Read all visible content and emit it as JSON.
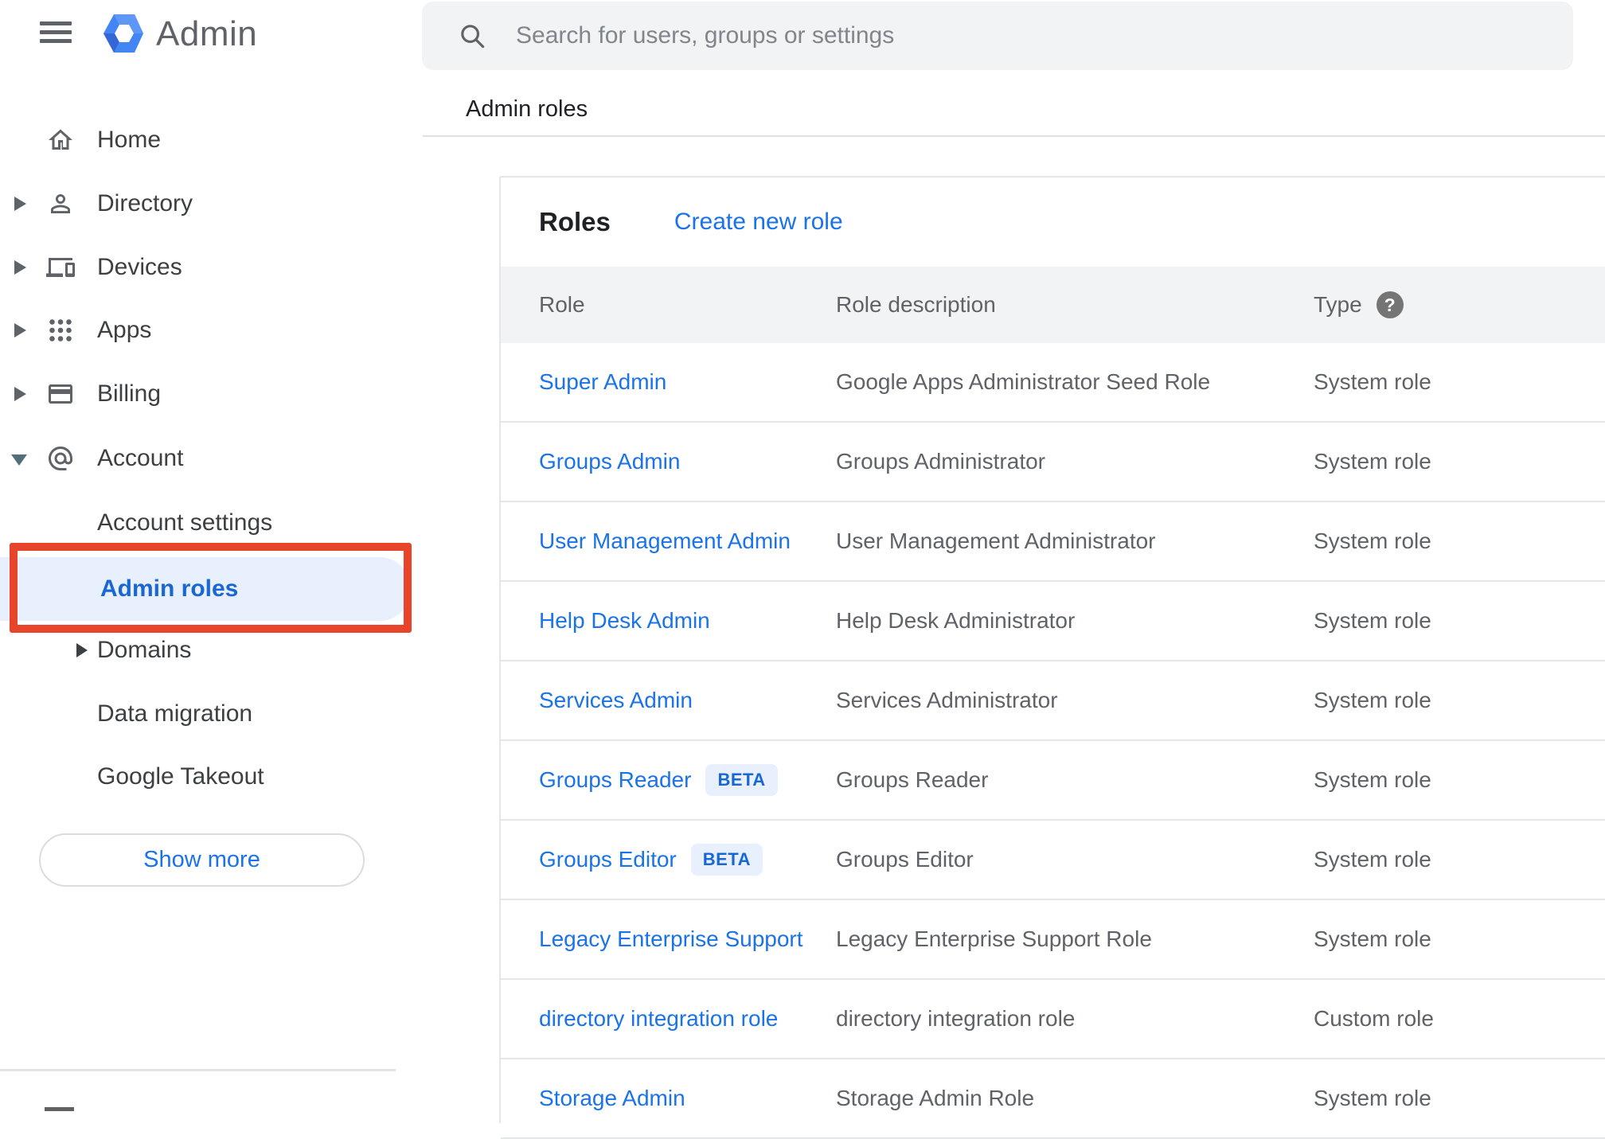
{
  "app": {
    "name": "Admin"
  },
  "search": {
    "placeholder": "Search for users, groups or settings"
  },
  "breadcrumb": {
    "title": "Admin roles"
  },
  "sidebar": {
    "items": [
      {
        "label": "Home"
      },
      {
        "label": "Directory"
      },
      {
        "label": "Devices"
      },
      {
        "label": "Apps"
      },
      {
        "label": "Billing"
      },
      {
        "label": "Account"
      }
    ],
    "account_subitems": [
      {
        "label": "Account settings"
      },
      {
        "label": "Admin roles",
        "selected": true,
        "annotated": true
      },
      {
        "label": "Domains"
      },
      {
        "label": "Data migration"
      },
      {
        "label": "Google Takeout"
      }
    ],
    "show_more_label": "Show more"
  },
  "content": {
    "card_title": "Roles",
    "create_link": "Create new role",
    "table": {
      "columns": [
        "Role",
        "Role description",
        "Type"
      ],
      "beta_label": "BETA",
      "rows": [
        {
          "role": "Super Admin",
          "beta": false,
          "description": "Google Apps Administrator Seed Role",
          "type": "System role"
        },
        {
          "role": "Groups Admin",
          "beta": false,
          "description": "Groups Administrator",
          "type": "System role"
        },
        {
          "role": "User Management Admin",
          "beta": false,
          "description": "User Management Administrator",
          "type": "System role"
        },
        {
          "role": "Help Desk Admin",
          "beta": false,
          "description": "Help Desk Administrator",
          "type": "System role"
        },
        {
          "role": "Services Admin",
          "beta": false,
          "description": "Services Administrator",
          "type": "System role"
        },
        {
          "role": "Groups Reader",
          "beta": true,
          "description": "Groups Reader",
          "type": "System role"
        },
        {
          "role": "Groups Editor",
          "beta": true,
          "description": "Groups Editor",
          "type": "System role"
        },
        {
          "role": "Legacy Enterprise Support",
          "beta": false,
          "description": "Legacy Enterprise Support Role",
          "type": "System role"
        },
        {
          "role": "directory integration role",
          "beta": false,
          "description": "directory integration role",
          "type": "Custom role"
        },
        {
          "role": "Storage Admin",
          "beta": false,
          "description": "Storage Admin Role",
          "type": "System role"
        }
      ]
    }
  },
  "colors": {
    "accent_blue": "#1a73e8",
    "selected_text": "#1967d2",
    "selected_bg": "#e8f0fe",
    "annotation_red": "#e8432b",
    "beta_bg": "#e8f0fe",
    "beta_text": "#1967d2",
    "table_header_bg": "#f1f3f4",
    "searchbar_bg": "#f1f3f4",
    "text_primary": "#202124",
    "text_secondary": "#5f6368",
    "logo_blue": "#4285f4"
  }
}
